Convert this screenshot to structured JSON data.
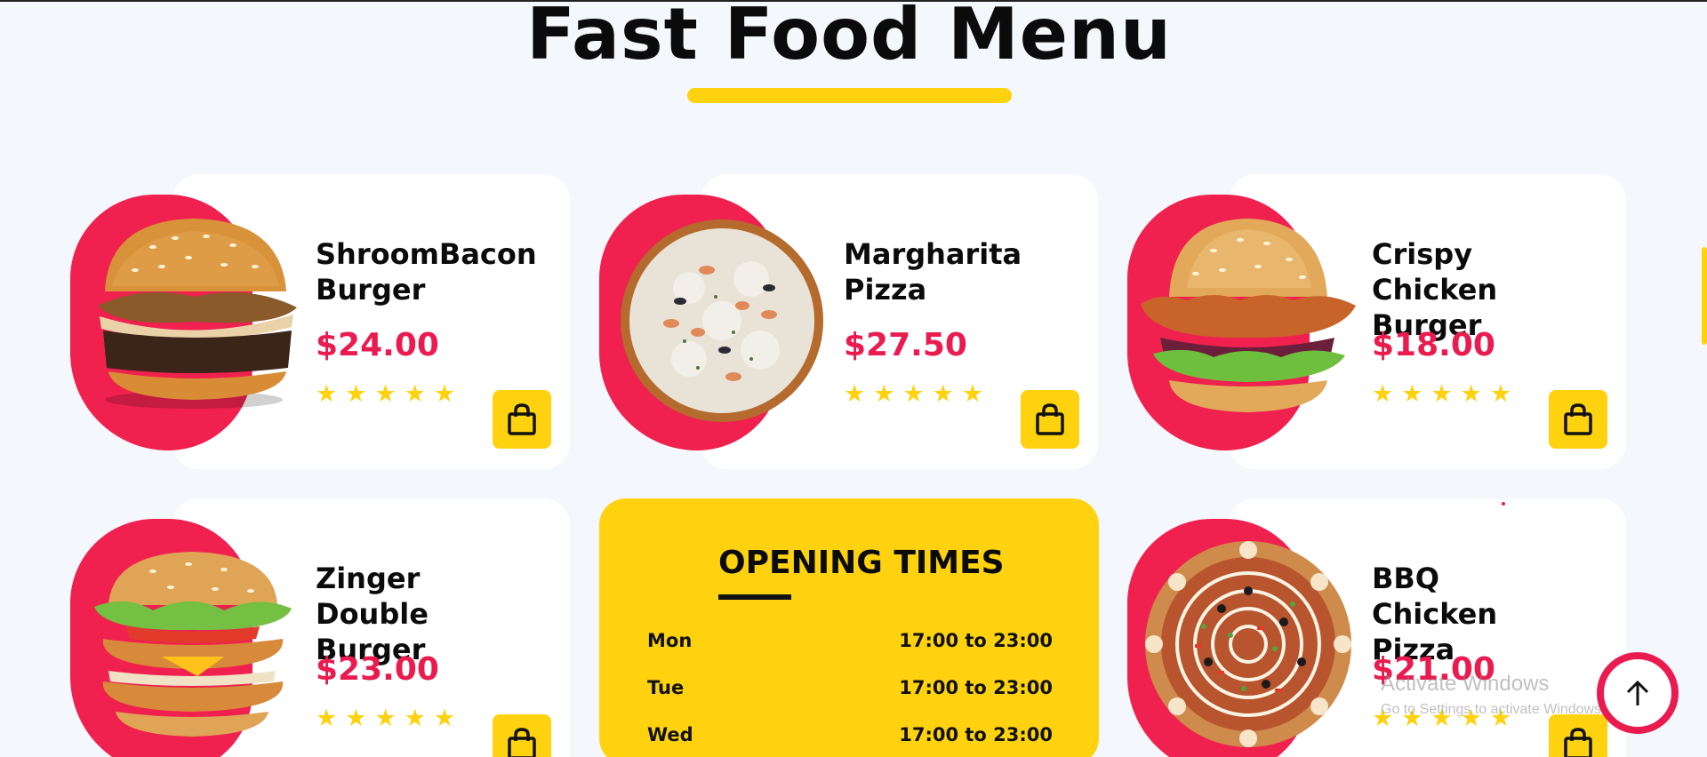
{
  "page": {
    "title": "Fast Food Menu",
    "accent_color": "#ffd20f",
    "brand_color": "#f0214f"
  },
  "menu_items": [
    {
      "name": "ShroomBacon Burger",
      "price": "$24.00",
      "rating": 5,
      "image_icon": "mushroom-bacon-burger-image",
      "cart_icon": "shopping-bag-icon"
    },
    {
      "name": "Margharita Pizza",
      "price": "$27.50",
      "rating": 5,
      "image_icon": "seafood-pizza-image",
      "cart_icon": "shopping-bag-icon"
    },
    {
      "name": "Crispy Chicken Burger",
      "price": "$18.00",
      "rating": 5,
      "image_icon": "crispy-chicken-burger-image",
      "cart_icon": "shopping-bag-icon"
    },
    {
      "name": "Zinger Double Burger",
      "price": "$23.00",
      "rating": 5,
      "image_icon": "zinger-double-burger-image",
      "cart_icon": "shopping-bag-icon"
    },
    {
      "name": "BBQ Chicken Pizza",
      "price": "$21.00",
      "rating": 5,
      "image_icon": "bbq-chicken-pizza-image",
      "cart_icon": "shopping-bag-icon"
    }
  ],
  "opening_times": {
    "title": "OPENING TIMES",
    "rows": [
      {
        "day": "Mon",
        "hours": "17:00 to 23:00"
      },
      {
        "day": "Tue",
        "hours": "17:00 to 23:00"
      },
      {
        "day": "Wed",
        "hours": "17:00 to 23:00"
      }
    ]
  },
  "scroll_top": {
    "icon": "arrow-up-icon"
  },
  "os_watermark": {
    "line1": "Activate Windows",
    "line2": "Go to Settings to activate Windows."
  }
}
